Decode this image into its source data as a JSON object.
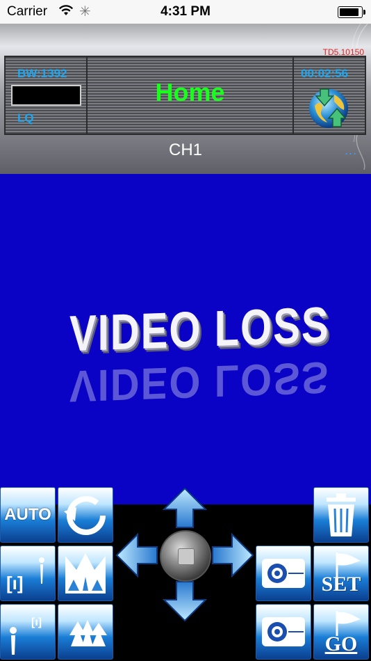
{
  "status_bar": {
    "carrier": "Carrier",
    "time": "4:31 PM"
  },
  "header": {
    "bandwidth": "BW:1392",
    "quality": "LQ",
    "location": "Home",
    "elapsed": "00:02:56",
    "version": "TD5.10150",
    "channel": "CH1",
    "more": "..."
  },
  "video": {
    "message": "VIDEO LOSS"
  },
  "controls": {
    "auto_label": "AUTO",
    "set_label": "SET",
    "go_label": "GO"
  },
  "colors": {
    "accent_blue": "#1ea8f2",
    "home_green": "#19ff1c",
    "video_bg": "#0a02c4",
    "version_red": "#e32020"
  },
  "icons": [
    "wifi-icon",
    "activity-spinner-icon",
    "battery-icon",
    "globe-sync-icon",
    "refresh-icon",
    "zoom-in-icon",
    "zoom-out-icon",
    "focus-near-icon",
    "focus-far-icon",
    "arrow-up-icon",
    "arrow-down-icon",
    "arrow-left-icon",
    "arrow-right-icon",
    "trash-icon",
    "camera-icon",
    "flag-icon"
  ]
}
